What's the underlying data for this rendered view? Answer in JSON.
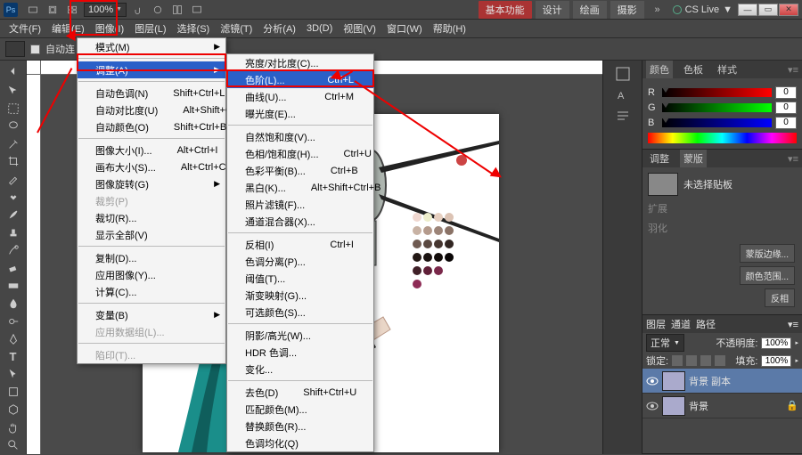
{
  "titlebar": {
    "app_abbrev": "Ps",
    "zoom": "100%",
    "right_pill": "基本功能",
    "tabs": [
      "设计",
      "绘画",
      "摄影"
    ],
    "cslive": "CS Live"
  },
  "menubar": {
    "items": [
      "文件(F)",
      "编辑(E)",
      "图像(I)",
      "图层(L)",
      "选择(S)",
      "滤镜(T)",
      "分析(A)",
      "3D(D)",
      "视图(V)",
      "窗口(W)",
      "帮助(H)"
    ]
  },
  "optionbar": {
    "auto_checkbox_label": "自动连"
  },
  "menu_image": {
    "items": [
      {
        "label": "模式(M)",
        "arrow": true
      },
      {
        "sep": true
      },
      {
        "label": "调整(A)",
        "arrow": true,
        "hilite": true
      },
      {
        "sep": true
      },
      {
        "label": "自动色调(N)",
        "shortcut": "Shift+Ctrl+L"
      },
      {
        "label": "自动对比度(U)",
        "shortcut": "Alt+Shift+Ctrl+L"
      },
      {
        "label": "自动颜色(O)",
        "shortcut": "Shift+Ctrl+B"
      },
      {
        "sep": true
      },
      {
        "label": "图像大小(I)...",
        "shortcut": "Alt+Ctrl+I"
      },
      {
        "label": "画布大小(S)...",
        "shortcut": "Alt+Ctrl+C"
      },
      {
        "label": "图像旋转(G)",
        "arrow": true
      },
      {
        "label": "裁剪(P)",
        "dis": true
      },
      {
        "label": "裁切(R)..."
      },
      {
        "label": "显示全部(V)"
      },
      {
        "sep": true
      },
      {
        "label": "复制(D)..."
      },
      {
        "label": "应用图像(Y)..."
      },
      {
        "label": "计算(C)..."
      },
      {
        "sep": true
      },
      {
        "label": "变量(B)",
        "arrow": true
      },
      {
        "label": "应用数据组(L)...",
        "dis": true
      },
      {
        "sep": true
      },
      {
        "label": "陷印(T)...",
        "dis": true
      }
    ]
  },
  "menu_adjust": {
    "items": [
      {
        "label": "亮度/对比度(C)..."
      },
      {
        "label": "色阶(L)...",
        "shortcut": "Ctrl+L",
        "hilite": true
      },
      {
        "label": "曲线(U)...",
        "shortcut": "Ctrl+M"
      },
      {
        "label": "曝光度(E)..."
      },
      {
        "sep": true
      },
      {
        "label": "自然饱和度(V)..."
      },
      {
        "label": "色相/饱和度(H)...",
        "shortcut": "Ctrl+U"
      },
      {
        "label": "色彩平衡(B)...",
        "shortcut": "Ctrl+B"
      },
      {
        "label": "黑白(K)...",
        "shortcut": "Alt+Shift+Ctrl+B"
      },
      {
        "label": "照片滤镜(F)..."
      },
      {
        "label": "通道混合器(X)..."
      },
      {
        "sep": true
      },
      {
        "label": "反相(I)",
        "shortcut": "Ctrl+I"
      },
      {
        "label": "色调分离(P)..."
      },
      {
        "label": "阈值(T)..."
      },
      {
        "label": "渐变映射(G)..."
      },
      {
        "label": "可选颜色(S)..."
      },
      {
        "sep": true
      },
      {
        "label": "阴影/高光(W)..."
      },
      {
        "label": "HDR 色调..."
      },
      {
        "label": "变化..."
      },
      {
        "sep": true
      },
      {
        "label": "去色(D)",
        "shortcut": "Shift+Ctrl+U"
      },
      {
        "label": "匹配颜色(M)..."
      },
      {
        "label": "替换颜色(R)..."
      },
      {
        "label": "色调均化(Q)"
      }
    ]
  },
  "color_panel": {
    "tabs": [
      "颜色",
      "色板",
      "样式"
    ],
    "r": "0",
    "g": "0",
    "b": "0"
  },
  "adjust_panel": {
    "tabs": [
      "调整",
      "蒙版"
    ],
    "no_sel": "未选择贴板",
    "expand": "扩展",
    "soften": "羽化",
    "btn_edge": "蒙版边缘...",
    "btn_range": "颜色范围...",
    "btn_invert": "反相"
  },
  "layers_panel": {
    "tabs": [
      "图层",
      "通道",
      "路径"
    ],
    "blend": "正常",
    "opacity_label": "不透明度:",
    "opacity": "100%",
    "lock_label": "锁定:",
    "fill_label": "填充:",
    "fill": "100%",
    "layer1": "背景 副本",
    "layer2": "背景"
  }
}
